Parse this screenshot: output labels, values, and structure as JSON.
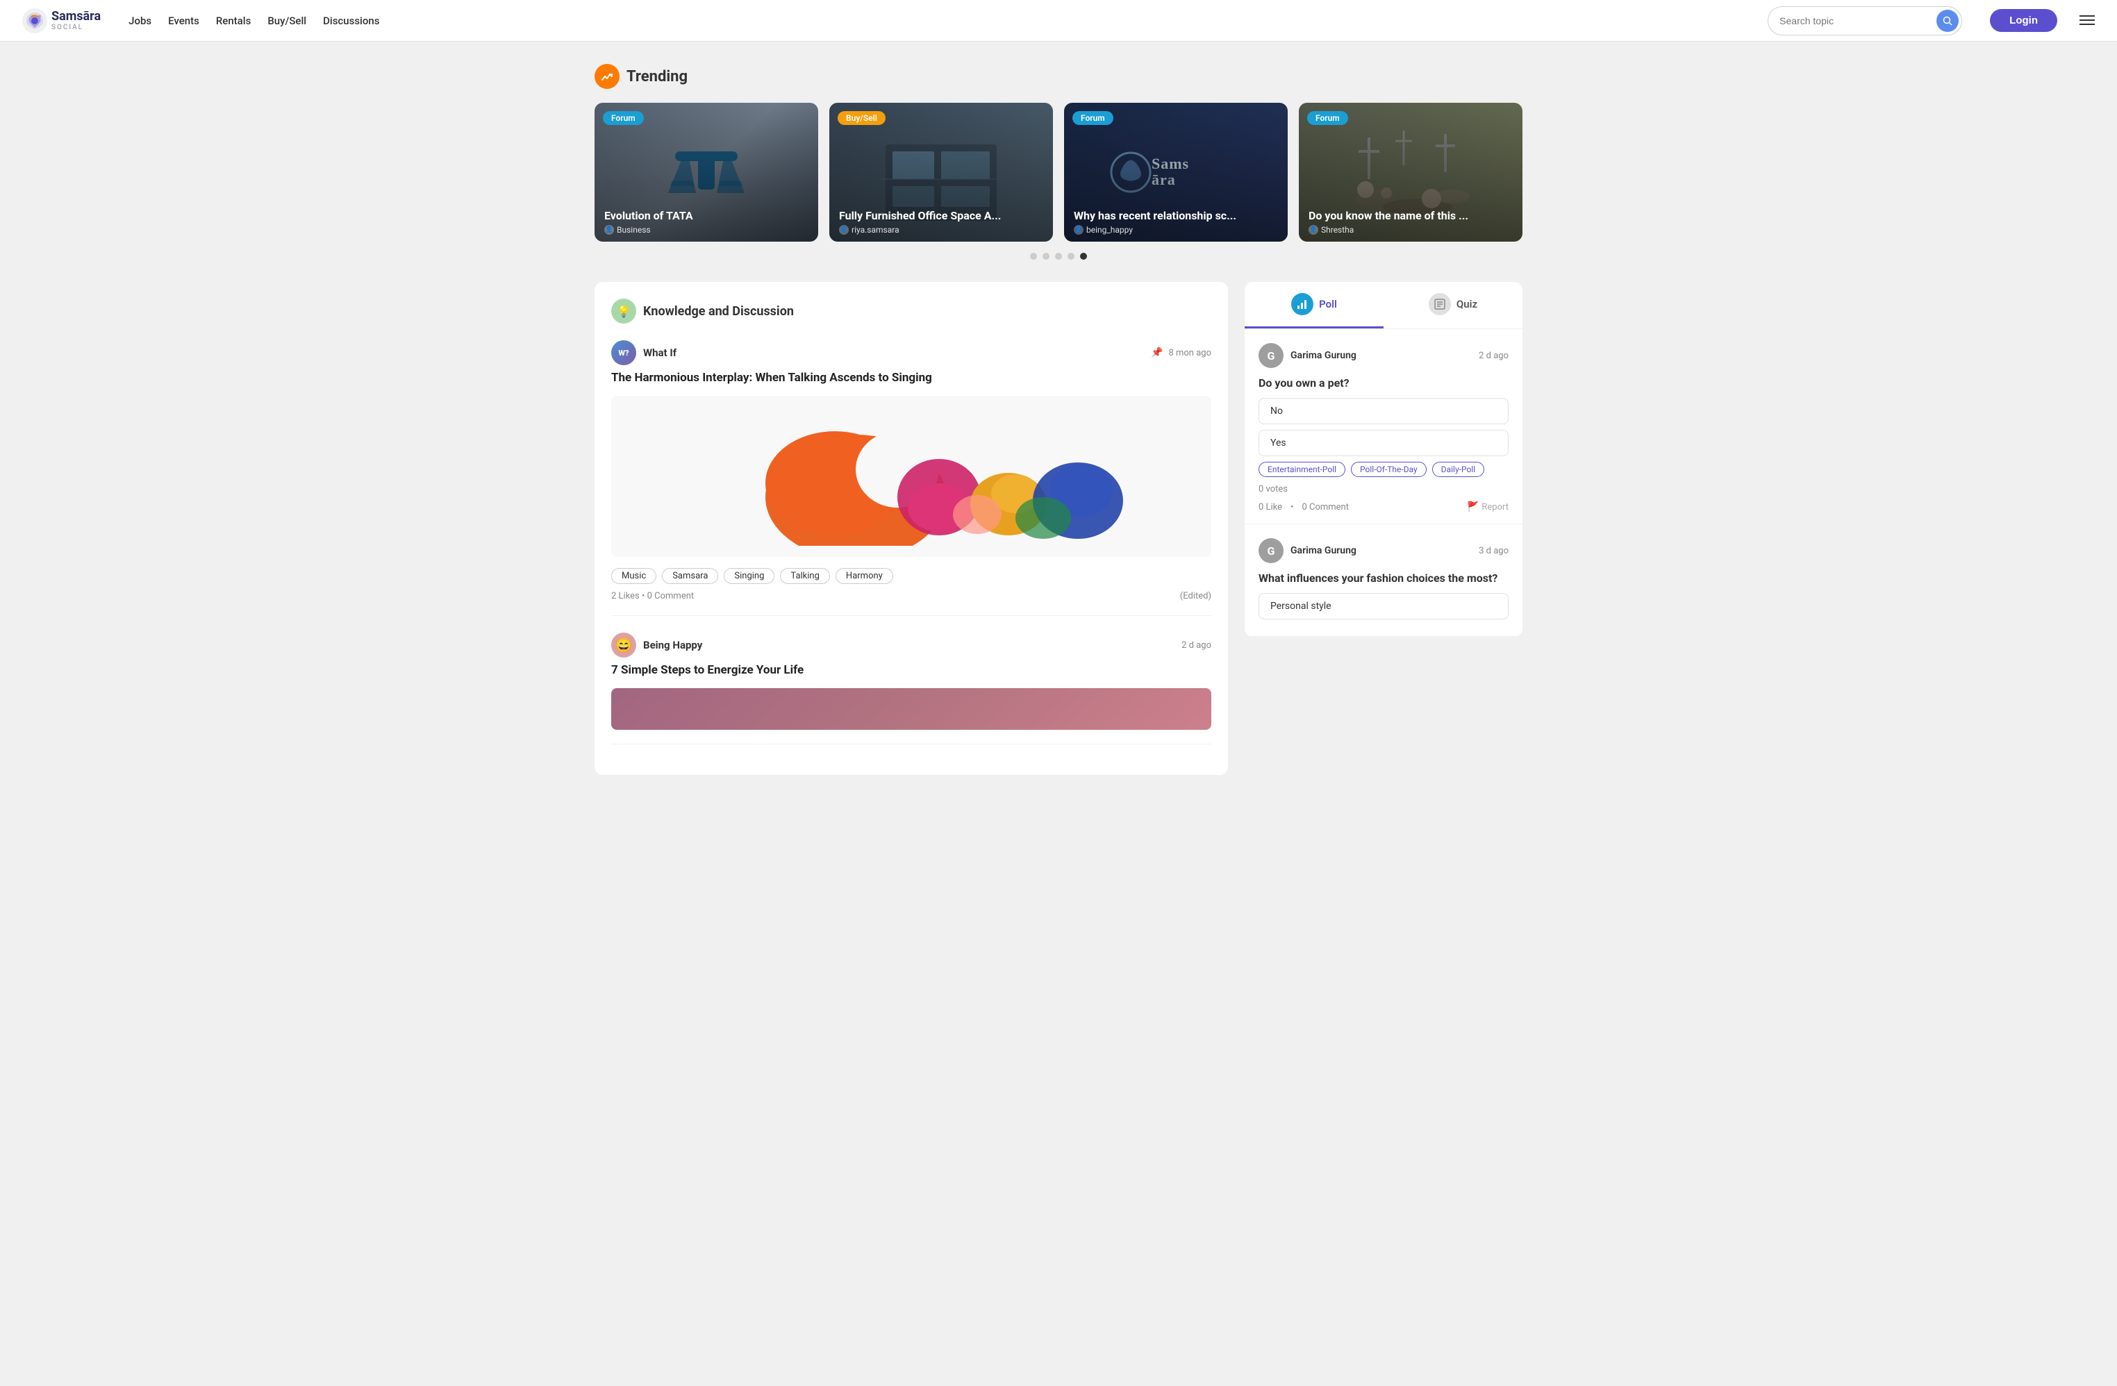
{
  "header": {
    "logo_text": "Samsāra",
    "logo_sub": "SOCIAL",
    "nav": [
      {
        "label": "Jobs",
        "id": "jobs"
      },
      {
        "label": "Events",
        "id": "events"
      },
      {
        "label": "Rentals",
        "id": "rentals"
      },
      {
        "label": "Buy/Sell",
        "id": "buysell"
      },
      {
        "label": "Discussions",
        "id": "discussions"
      }
    ],
    "search_placeholder": "Search topic",
    "login_label": "Login"
  },
  "trending": {
    "title": "Trending",
    "cards": [
      {
        "badge": "Forum",
        "badge_type": "forum",
        "title": "Evolution of TATA",
        "author": "Business",
        "bg": "tata"
      },
      {
        "badge": "Buy/Sell",
        "badge_type": "buysell",
        "title": "Fully Furnished Office Space A...",
        "author": "riya.samsara",
        "bg": "office"
      },
      {
        "badge": "Forum",
        "badge_type": "forum",
        "title": "Why has recent relationship sc...",
        "author": "being_happy",
        "bg": "samsara"
      },
      {
        "badge": "Forum",
        "badge_type": "forum",
        "title": "Do you know the name of this ...",
        "author": "Shrestha",
        "bg": "nature"
      }
    ],
    "dots": [
      false,
      false,
      false,
      false,
      true
    ]
  },
  "knowledge": {
    "section_title": "Knowledge and Discussion",
    "posts": [
      {
        "category": "What If",
        "time": "8 mon ago",
        "pinned": true,
        "title": "The Harmonious Interplay: When Talking Ascends to Singing",
        "tags": [
          "Music",
          "Samsara",
          "Singing",
          "Talking",
          "Harmony"
        ],
        "likes": "2 Likes",
        "comments": "0 Comment",
        "edited": true
      },
      {
        "author": "Being Happy",
        "time": "2 d ago",
        "title": "7 Simple Steps to Energize Your Life",
        "tags": []
      }
    ]
  },
  "right_panel": {
    "tabs": [
      {
        "label": "Poll",
        "active": true
      },
      {
        "label": "Quiz",
        "active": false
      }
    ],
    "polls": [
      {
        "author": "Garima Gurung",
        "time": "2 d ago",
        "question": "Do you own a pet?",
        "options": [
          "No",
          "Yes"
        ],
        "tags": [
          "Entertainment-Poll",
          "Poll-Of-The-Day",
          "Daily-Poll"
        ],
        "votes": "0 votes",
        "likes": "0 Like",
        "comments": "0 Comment",
        "report": "Report"
      },
      {
        "author": "Garima Gurung",
        "time": "3 d ago",
        "question": "What influences your fashion choices the most?",
        "options": [
          "Personal style"
        ],
        "tags": [],
        "votes": "",
        "likes": "",
        "comments": "",
        "report": ""
      }
    ]
  }
}
